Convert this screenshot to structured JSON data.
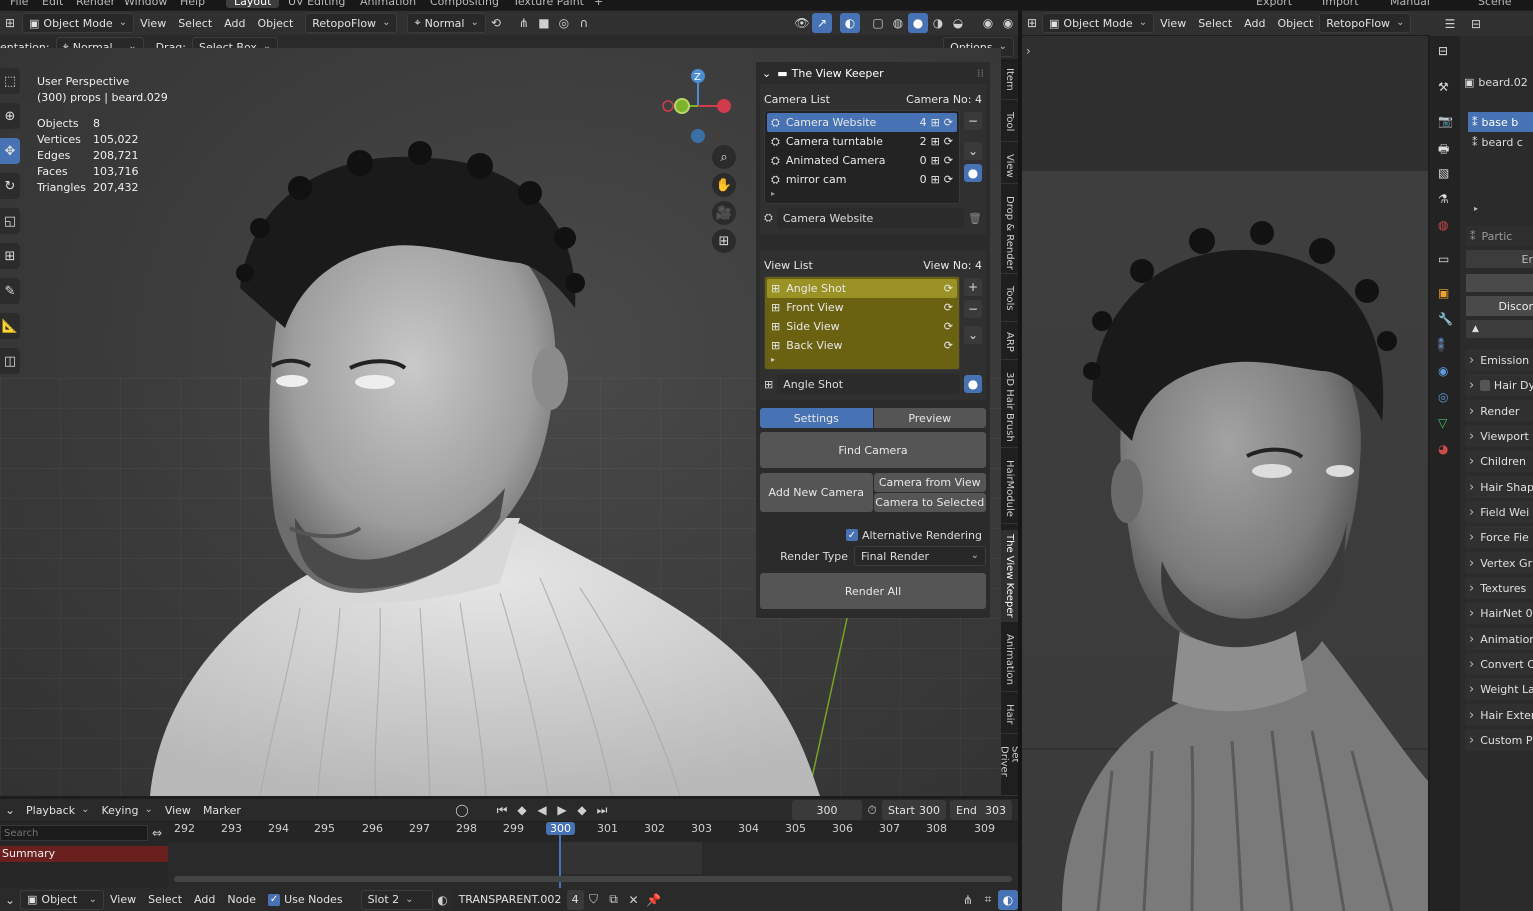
{
  "top_menu": {
    "file": "File",
    "edit": "Edit",
    "render": "Render",
    "window": "Window",
    "help": "Help"
  },
  "workspaces": [
    "Layout",
    "UV Editing",
    "Animation",
    "Compositing",
    "Texture Paint"
  ],
  "right_workspaces": [
    "Export",
    "Import",
    "Manual"
  ],
  "scene_label": "Scene",
  "vp_header": {
    "mode": "Object Mode",
    "view": "View",
    "select": "Select",
    "add": "Add",
    "object": "Object",
    "retopo": "RetopoFlow",
    "orient": "Normal"
  },
  "tool_header": {
    "orientation_label": "entation:",
    "orientation": "Normal",
    "drag_label": "Drag:",
    "drag": "Select Box",
    "options": "Options"
  },
  "overlay": {
    "perspective": "User Perspective",
    "collection": "(300) props | beard.029",
    "stats": [
      {
        "k": "Objects",
        "v": "8"
      },
      {
        "k": "Vertices",
        "v": "105,022"
      },
      {
        "k": "Edges",
        "v": "208,721"
      },
      {
        "k": "Faces",
        "v": "103,716"
      },
      {
        "k": "Triangles",
        "v": "207,432"
      }
    ]
  },
  "gizmo": {
    "z": "Z"
  },
  "viewkeeper": {
    "title": "The View Keeper",
    "camera_list_label": "Camera List",
    "camera_no_label": "Camera No:",
    "camera_no": "4",
    "cameras": [
      {
        "name": "Camera Website",
        "num": "4"
      },
      {
        "name": "Camera turntable",
        "num": "2"
      },
      {
        "name": "Animated Camera",
        "num": "0"
      },
      {
        "name": "mirror cam",
        "num": "0"
      }
    ],
    "active_camera": "Camera Website",
    "view_list_label": "View List",
    "view_no_label": "View No:",
    "view_no": "4",
    "views": [
      "Angle Shot",
      "Front View",
      "Side View",
      "Back View"
    ],
    "active_view": "Angle Shot",
    "tab_settings": "Settings",
    "tab_preview": "Preview",
    "find_camera": "Find Camera",
    "add_new_camera": "Add New Camera",
    "camera_from_view": "Camera from View",
    "camera_to_selected": "Camera to Selected",
    "alt_render": "Alternative Rendering",
    "render_type_label": "Render Type",
    "render_type": "Final Render",
    "render_all": "Render All"
  },
  "vtabs": [
    "Item",
    "Tool",
    "View",
    "Drop & Render",
    "Tools",
    "ARP",
    "3D Hair Brush",
    "HairModule",
    "The View Keeper",
    "Animation",
    "Hair",
    "Set Driver"
  ],
  "timeline": {
    "playback": "Playback",
    "keying": "Keying",
    "view": "View",
    "marker": "Marker",
    "current": "300",
    "start_label": "Start",
    "start": "300",
    "end_label": "End",
    "end": "303",
    "search_placeholder": "Search",
    "summary": "Summary",
    "frames": [
      "292",
      "293",
      "294",
      "295",
      "296",
      "297",
      "298",
      "299",
      "300",
      "301",
      "302",
      "303",
      "304",
      "305",
      "306",
      "307",
      "308",
      "309"
    ]
  },
  "node_header": {
    "editor": "Object",
    "view": "View",
    "select": "Select",
    "add": "Add",
    "node": "Node",
    "use_nodes": "Use Nodes",
    "slot": "Slot 2",
    "material": "TRANSPARENT.002",
    "users": "4"
  },
  "right_header": {
    "mode": "Object Mode",
    "view": "View",
    "select": "Select",
    "add": "Add",
    "object": "Object",
    "retopo": "RetopoFlow"
  },
  "properties": {
    "object_name": "beard.02",
    "outliner_items": [
      "base b",
      "beard c"
    ],
    "particles": "Partic",
    "er": "Er",
    "discor": "Discor",
    "panels": [
      "Emission",
      "Hair Dy",
      "Render",
      "Viewport",
      "Children",
      "Hair Shap",
      "Field Wei",
      "Force Fie",
      "Vertex Gr",
      "Textures",
      "HairNet 0.",
      "Animation",
      "Convert C",
      "Weight La",
      "Hair Exter",
      "Custom P"
    ]
  }
}
